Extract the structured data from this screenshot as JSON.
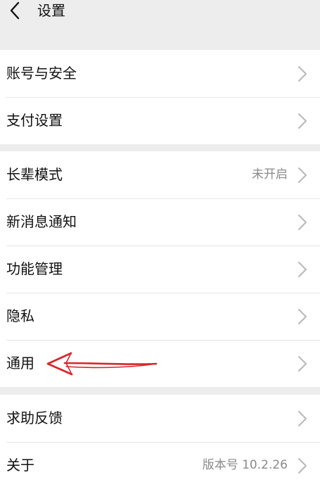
{
  "header": {
    "title": "设置",
    "back_icon": "chevron-left-icon"
  },
  "groups": [
    {
      "items": [
        {
          "label": "账号与安全",
          "value": ""
        },
        {
          "label": "支付设置",
          "value": ""
        }
      ]
    },
    {
      "items": [
        {
          "label": "长辈模式",
          "value": "未开启"
        },
        {
          "label": "新消息通知",
          "value": ""
        },
        {
          "label": "功能管理",
          "value": ""
        },
        {
          "label": "隐私",
          "value": ""
        },
        {
          "label": "通用",
          "value": ""
        }
      ]
    },
    {
      "items": [
        {
          "label": "求助反馈",
          "value": ""
        },
        {
          "label": "关于",
          "value": "版本号 10.2.26"
        }
      ]
    }
  ],
  "annotation": {
    "arrow_color": "#d9252b",
    "arrow_target": "通用"
  },
  "colors": {
    "background": "#ededed",
    "card": "#ffffff",
    "secondary_text": "#8a8a8a",
    "chevron": "#b8b8b8"
  }
}
